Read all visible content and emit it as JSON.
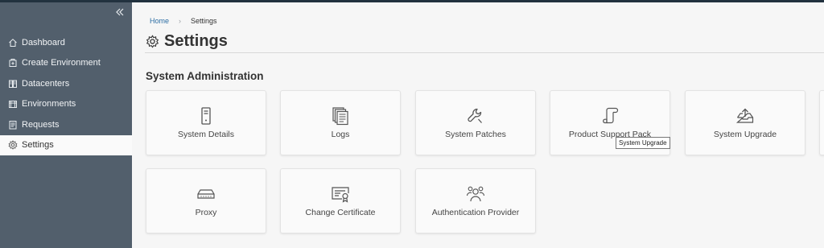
{
  "sidebar": {
    "collapse_icon": "double-chevron-left-icon",
    "items": [
      {
        "label": "Dashboard",
        "icon": "home-icon"
      },
      {
        "label": "Create Environment",
        "icon": "create-environment-icon"
      },
      {
        "label": "Datacenters",
        "icon": "datacenter-icon"
      },
      {
        "label": "Environments",
        "icon": "environments-icon"
      },
      {
        "label": "Requests",
        "icon": "requests-icon"
      },
      {
        "label": "Settings",
        "icon": "gear-icon",
        "active": true
      }
    ]
  },
  "breadcrumb": {
    "home": "Home",
    "separator": "›",
    "current": "Settings"
  },
  "page": {
    "title": "Settings",
    "title_icon": "gear-icon"
  },
  "section": {
    "title": "System Administration"
  },
  "cards": [
    {
      "label": "System Details",
      "icon": "server-icon"
    },
    {
      "label": "Logs",
      "icon": "logs-icon"
    },
    {
      "label": "System Patches",
      "icon": "wrench-icon"
    },
    {
      "label": "Product Support Pack",
      "icon": "scroll-icon"
    },
    {
      "label": "System Upgrade",
      "icon": "upload-tray-icon"
    },
    {
      "label": "Proxy",
      "icon": "network-device-icon"
    },
    {
      "label": "Change Certificate",
      "icon": "certificate-icon"
    },
    {
      "label": "Authentication Provider",
      "icon": "users-group-icon"
    }
  ],
  "tooltip": {
    "text": "System Upgrade"
  },
  "colors": {
    "sidebar_bg": "#525f6c",
    "topbar": "#22323f",
    "link": "#2d6ea4",
    "main_bg": "#f6f6f6"
  }
}
